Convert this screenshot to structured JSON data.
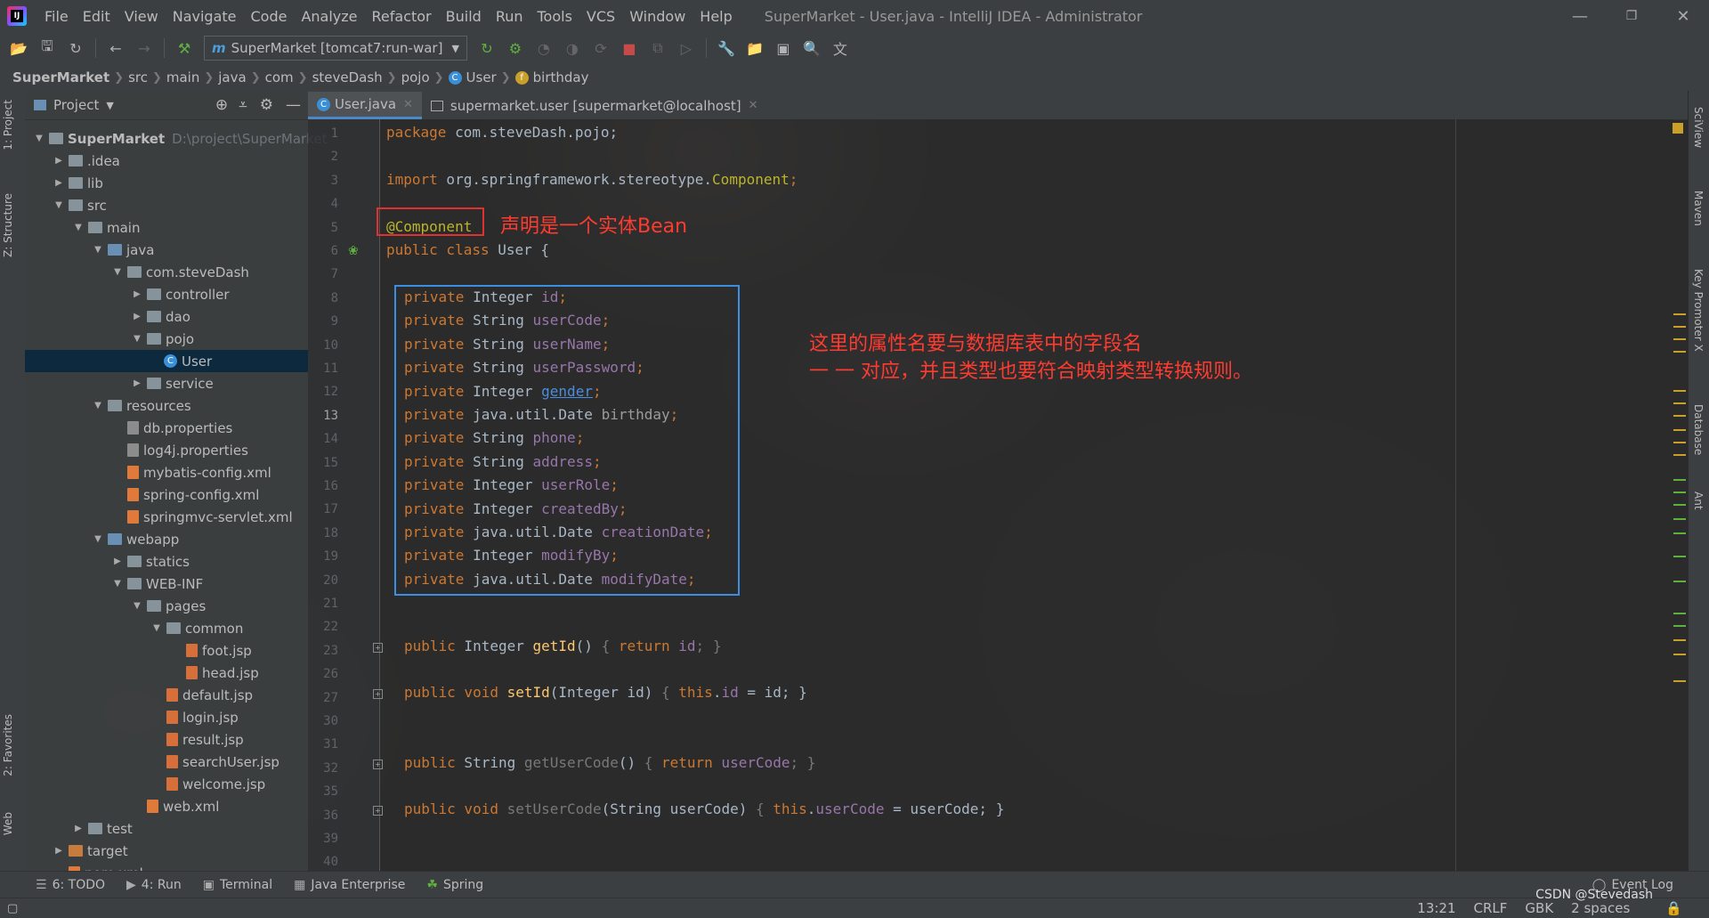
{
  "menubar": {
    "items": [
      "File",
      "Edit",
      "View",
      "Navigate",
      "Code",
      "Analyze",
      "Refactor",
      "Build",
      "Run",
      "Tools",
      "VCS",
      "Window",
      "Help"
    ],
    "window_title": "SuperMarket - User.java - IntelliJ IDEA - Administrator"
  },
  "toolbar": {
    "run_config": "SuperMarket [tomcat7:run-war]"
  },
  "breadcrumb": [
    "SuperMarket",
    "src",
    "main",
    "java",
    "com",
    "steveDash",
    "pojo",
    "User",
    "birthday"
  ],
  "left_tabs": [
    "1: Project",
    "Z: Structure",
    "2: Favorites",
    "Web"
  ],
  "project": {
    "header": "Project",
    "root_path": "D:\\project\\SuperMarket",
    "tree": [
      "SuperMarket",
      ".idea",
      "lib",
      "src",
      "main",
      "java",
      "com.steveDash",
      "controller",
      "dao",
      "pojo",
      "User",
      "service",
      "resources",
      "db.properties",
      "log4j.properties",
      "mybatis-config.xml",
      "spring-config.xml",
      "springmvc-servlet.xml",
      "webapp",
      "statics",
      "WEB-INF",
      "pages",
      "common",
      "foot.jsp",
      "head.jsp",
      "default.jsp",
      "login.jsp",
      "result.jsp",
      "searchUser.jsp",
      "welcome.jsp",
      "web.xml",
      "test",
      "target",
      "pom.xml"
    ]
  },
  "editor_tabs": [
    "User.java",
    "supermarket.user [supermarket@localhost]"
  ],
  "line_numbers": [
    "1",
    "2",
    "3",
    "4",
    "5",
    "6",
    "7",
    "8",
    "9",
    "10",
    "11",
    "12",
    "13",
    "14",
    "15",
    "16",
    "17",
    "18",
    "19",
    "20",
    "21",
    "22",
    "23",
    "26",
    "27",
    "30",
    "31",
    "32",
    "35",
    "36",
    "39",
    "40"
  ],
  "code": {
    "l1": [
      "package",
      " com.steveDash.pojo;"
    ],
    "l3": [
      "import",
      " org.springframework.stereotype.",
      "Component",
      ";"
    ],
    "l5": "@Component",
    "l6": [
      "public class",
      " User {"
    ],
    "fields": [
      {
        "type": "Integer",
        "name": "id"
      },
      {
        "type": "String",
        "name": "userCode"
      },
      {
        "type": "String",
        "name": "userName"
      },
      {
        "type": "String",
        "name": "userPassword"
      },
      {
        "type": "Integer",
        "name": "gender"
      },
      {
        "type": "java.util.Date",
        "name": "birthday"
      },
      {
        "type": "String",
        "name": "phone"
      },
      {
        "type": "String",
        "name": "address"
      },
      {
        "type": "Integer",
        "name": "userRole"
      },
      {
        "type": "Integer",
        "name": "createdBy"
      },
      {
        "type": "java.util.Date",
        "name": "creationDate"
      },
      {
        "type": "Integer",
        "name": "modifyBy"
      },
      {
        "type": "java.util.Date",
        "name": "modifyDate"
      }
    ],
    "private_kw": "private",
    "m1": [
      "public",
      " Integer ",
      "getId",
      "() ",
      "{ ",
      "return",
      " id",
      "; }"
    ],
    "m2": [
      "public void",
      " ",
      "setId",
      "(Integer id) ",
      "{ ",
      "this",
      ".",
      "id",
      " = id; }"
    ],
    "m3": [
      "public",
      " String ",
      "getUserCode",
      "() ",
      "{ ",
      "return",
      " userCode",
      "; }"
    ],
    "m4": [
      "public void",
      " ",
      "setUserCode",
      "(String userCode) ",
      "{ ",
      "this",
      ".",
      "userCode",
      " = userCode; }"
    ]
  },
  "annotations": {
    "note1": "声明是一个实体Bean",
    "note2_line1": "这里的属性名要与数据库表中的字段名",
    "note2_line2": "一 一 对应，并且类型也要符合映射类型转换规则。"
  },
  "right_tabs": [
    "SciView",
    "Maven",
    "Key Promoter X",
    "Database",
    "Ant"
  ],
  "bottom_tools": [
    "6: TODO",
    "4: Run",
    "Terminal",
    "Java Enterprise",
    "Spring"
  ],
  "event_log": "Event Log",
  "status": {
    "position": "13:21",
    "line_sep": "CRLF",
    "encoding": "GBK",
    "indent": "2 spaces",
    "watermark": "CSDN @Stevedash"
  },
  "colors": {
    "keyword": "#cc7832",
    "annotation": "#bbb529",
    "field": "#9876aa",
    "method": "#ffc66d",
    "note": "#ff3b30",
    "highlight_red": "#e03030",
    "highlight_blue": "#3c8fe0"
  }
}
